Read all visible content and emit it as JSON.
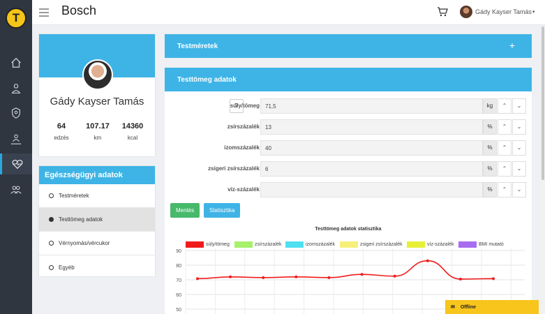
{
  "header": {
    "brand": "Bosch",
    "user_name": "Gády Kayser Tamás",
    "logo_letter": "T"
  },
  "profile": {
    "name": "Gády Kayser Tamás",
    "stats": [
      {
        "value": "64",
        "label": "edzés"
      },
      {
        "value": "107.17",
        "label": "km"
      },
      {
        "value": "14360",
        "label": "kcal"
      }
    ]
  },
  "health": {
    "title": "Egészségügyi adatok",
    "items": [
      "Testméretek",
      "Testtömeg adatok",
      "Vérnyomás/vércukor",
      "Egyéb"
    ],
    "selected": 1
  },
  "panel_testmeretek": {
    "title": "Testméretek",
    "plus": "+"
  },
  "panel_testtomeg": {
    "title": "Testtömeg adatok",
    "help": "?",
    "rows": [
      {
        "label": "súly/tömeg",
        "value": "71,5",
        "unit": "kg"
      },
      {
        "label": "zsírszázalék",
        "value": "13",
        "unit": "%"
      },
      {
        "label": "izomszázalék",
        "value": "40",
        "unit": "%"
      },
      {
        "label": "zsigeri zsírszázalék",
        "value": "6",
        "unit": "%"
      },
      {
        "label": "víz-százalék",
        "value": "",
        "unit": "%"
      }
    ],
    "save_label": "Mentés",
    "stats_label": "Statisztika"
  },
  "chart_data": {
    "type": "line",
    "title": "Testtömeg adatok statisztika",
    "ylim": [
      50,
      90
    ],
    "yticks": [
      90,
      80,
      70,
      60,
      50
    ],
    "grid": true,
    "legend_position": "top",
    "series": [
      {
        "name": "súly/tömeg",
        "color": "#f01c1c",
        "values": [
          70.8,
          72,
          71.5,
          72,
          71.5,
          73.7,
          72.5,
          83,
          70.5,
          70.8
        ]
      },
      {
        "name": "zsírszázalék",
        "color": "#a6f06a",
        "values": []
      },
      {
        "name": "izomszázalék",
        "color": "#4ee0f0",
        "values": []
      },
      {
        "name": "zsigeri zsírszázalék",
        "color": "#f6f07a",
        "values": []
      },
      {
        "name": "víz-százalék",
        "color": "#e8f036",
        "values": []
      },
      {
        "name": "BMI mutató",
        "color": "#a86cf0",
        "values": []
      }
    ]
  },
  "toast": {
    "label": "Offline"
  }
}
